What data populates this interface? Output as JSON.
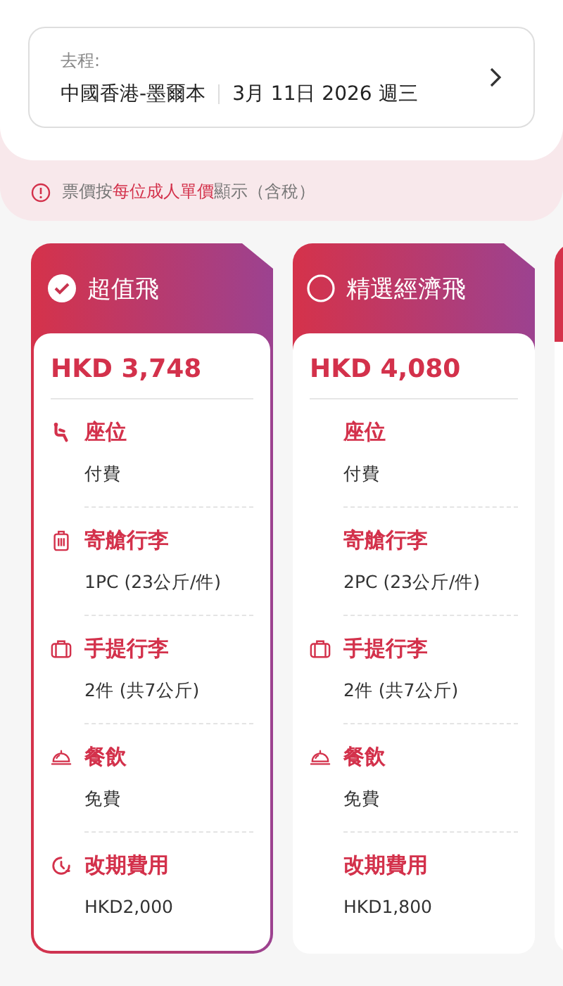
{
  "trip": {
    "label": "去程:",
    "route": "中國香港-墨爾本",
    "date": "3月 11日 2026 週三"
  },
  "notice": "票價按**每位成人單價**顯示（含稅）",
  "fares": [
    {
      "name": "超值飛",
      "selected": true,
      "price": "HKD 3,748",
      "features": [
        {
          "kind": "seat",
          "label": "座位",
          "value": "付費"
        },
        {
          "kind": "checked-bag",
          "label": "寄艙行李",
          "value": "1PC (23公斤/件)"
        },
        {
          "kind": "cabin-bag",
          "label": "手提行李",
          "value": "2件 (共7公斤)"
        },
        {
          "kind": "meal",
          "label": "餐飲",
          "value": "免費"
        },
        {
          "kind": "change",
          "label": "改期費用",
          "value": "HKD2,000"
        }
      ]
    },
    {
      "name": "精選經濟飛",
      "selected": false,
      "price": "HKD 4,080",
      "features": [
        {
          "kind": "plain",
          "label": "座位",
          "value": "付費"
        },
        {
          "kind": "plain",
          "label": "寄艙行李",
          "value": "2PC (23公斤/件)"
        },
        {
          "kind": "cabin-bag",
          "label": "手提行李",
          "value": "2件 (共7公斤)"
        },
        {
          "kind": "meal",
          "label": "餐飲",
          "value": "免費"
        },
        {
          "kind": "plain",
          "label": "改期費用",
          "value": "HKD1,800"
        }
      ]
    }
  ]
}
